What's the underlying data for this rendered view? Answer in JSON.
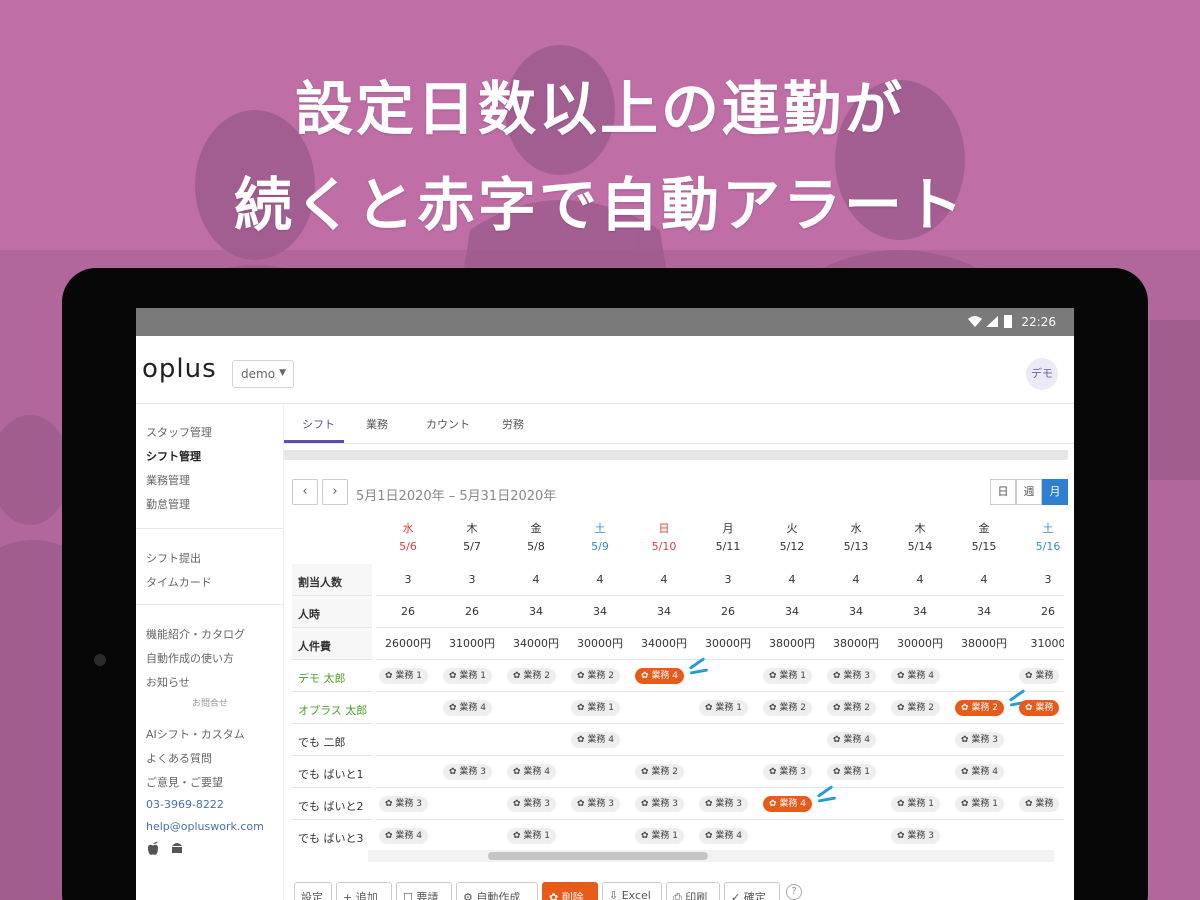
{
  "promo": {
    "line1": "設定日数以上の連勤が",
    "line2": "続くと赤字で自動アラート"
  },
  "statusbar": {
    "time": "22:26"
  },
  "app": {
    "logo": "oplus",
    "org_selector": "demo",
    "avatar": "デモ"
  },
  "sidebar": {
    "items": [
      "スタッフ管理",
      "シフト管理",
      "業務管理",
      "勤怠管理",
      "シフト提出",
      "タイムカード",
      "機能紹介・カタログ",
      "自動作成の使い方",
      "お知らせ"
    ],
    "contact_header": "お問合せ",
    "contact_items": [
      "AIシフト・カスタム",
      "よくある質問",
      "ご意見・ご要望"
    ],
    "phone": "03-3969-8222",
    "email": "help@opluswork.com"
  },
  "tabs": [
    "シフト",
    "業務",
    "カウント",
    "労務"
  ],
  "calendar": {
    "range": "5月1日2020年 – 5月31日2020年",
    "view_buttons": [
      "日",
      "週",
      "月"
    ],
    "active_view": "月",
    "days": [
      {
        "wd": "水",
        "date": "5/6",
        "type": "sun"
      },
      {
        "wd": "木",
        "date": "5/7",
        "type": ""
      },
      {
        "wd": "金",
        "date": "5/8",
        "type": ""
      },
      {
        "wd": "土",
        "date": "5/9",
        "type": "sat"
      },
      {
        "wd": "日",
        "date": "5/10",
        "type": "sun"
      },
      {
        "wd": "月",
        "date": "5/11",
        "type": ""
      },
      {
        "wd": "火",
        "date": "5/12",
        "type": ""
      },
      {
        "wd": "水",
        "date": "5/13",
        "type": ""
      },
      {
        "wd": "木",
        "date": "5/14",
        "type": ""
      },
      {
        "wd": "金",
        "date": "5/15",
        "type": ""
      },
      {
        "wd": "土",
        "date": "5/16",
        "type": "sat"
      }
    ],
    "summary_rows": [
      {
        "label": "割当人数",
        "values": [
          "3",
          "3",
          "4",
          "4",
          "4",
          "3",
          "4",
          "4",
          "4",
          "4",
          "3"
        ]
      },
      {
        "label": "人時",
        "values": [
          "26",
          "26",
          "34",
          "34",
          "34",
          "26",
          "34",
          "34",
          "34",
          "34",
          "26"
        ]
      },
      {
        "label": "人件費",
        "values": [
          "26000円",
          "31000円",
          "34000円",
          "30000円",
          "34000円",
          "30000円",
          "38000円",
          "38000円",
          "30000円",
          "38000円",
          "31000"
        ]
      }
    ],
    "staff": [
      {
        "name": "デモ 太郎",
        "style": "green",
        "shifts": [
          "業務 1",
          "業務 1",
          "業務 2",
          "業務 2",
          "業務 4",
          "",
          "業務 1",
          "業務 3",
          "業務 4",
          "",
          "業務"
        ],
        "alerts": [
          4
        ]
      },
      {
        "name": "オプラス 太郎",
        "style": "green",
        "shifts": [
          "",
          "業務 4",
          "",
          "業務 1",
          "",
          "業務 1",
          "業務 2",
          "業務 2",
          "業務 2",
          "業務 2",
          "業務"
        ],
        "alerts": [
          9,
          10
        ]
      },
      {
        "name": "でも 二郎",
        "style": "plain",
        "shifts": [
          "",
          "",
          "",
          "業務 4",
          "",
          "",
          "",
          "業務 4",
          "",
          "業務 3",
          ""
        ],
        "alerts": []
      },
      {
        "name": "でも ばいと1",
        "style": "plain",
        "shifts": [
          "",
          "業務 3",
          "業務 4",
          "",
          "業務 2",
          "",
          "業務 3",
          "業務 1",
          "",
          "業務 4",
          ""
        ],
        "alerts": []
      },
      {
        "name": "でも ばいと2",
        "style": "plain",
        "shifts": [
          "業務 3",
          "",
          "業務 3",
          "業務 3",
          "業務 3",
          "業務 3",
          "業務 4",
          "",
          "業務 1",
          "業務 1",
          "業務"
        ],
        "alerts": [
          6
        ]
      },
      {
        "name": "でも ばいと3",
        "style": "plain",
        "shifts": [
          "業務 4",
          "",
          "業務 1",
          "",
          "業務 1",
          "業務 4",
          "",
          "",
          "業務 3",
          "",
          ""
        ],
        "alerts": []
      }
    ]
  },
  "toolbar": [
    "設定",
    "追加",
    "要請",
    "自動作成",
    "削除",
    "Excel",
    "印刷",
    "確定"
  ],
  "colors": {
    "accent": "#5a4db2",
    "alert": "#e85a1a",
    "background": "#b86a9e"
  }
}
